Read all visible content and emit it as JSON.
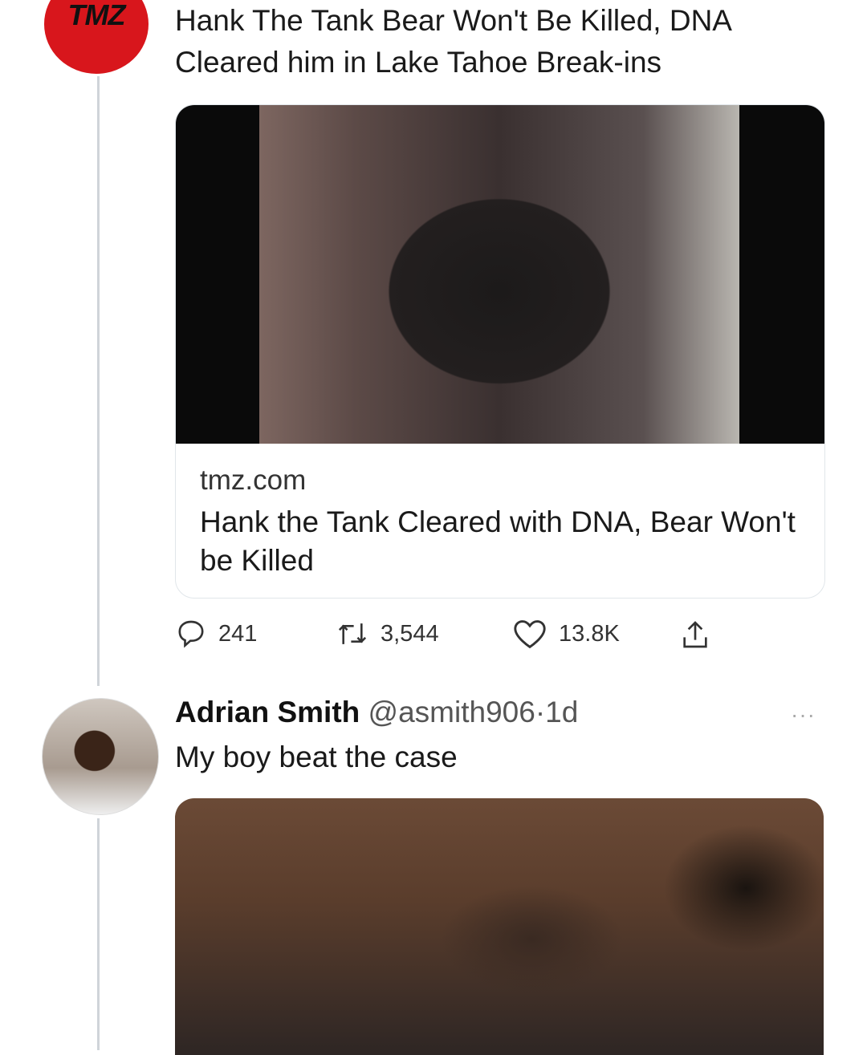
{
  "original_tweet": {
    "avatar_logo": "TMZ",
    "text": "Hank The Tank Bear Won't Be Killed, DNA Cleared him in Lake Tahoe Break-ins",
    "card": {
      "domain": "tmz.com",
      "title": "Hank the Tank Cleared with DNA, Bear Won't be Killed"
    },
    "actions": {
      "replies": "241",
      "retweets": "3,544",
      "likes": "13.8K"
    }
  },
  "reply_tweet": {
    "name": "Adrian Smith",
    "handle": "@asmith906",
    "separator": "·",
    "time": "1d",
    "more": "···",
    "text": "My boy beat the case"
  },
  "colors": {
    "tmz_red": "#d8161c",
    "thread_line": "#cfd4d9"
  }
}
